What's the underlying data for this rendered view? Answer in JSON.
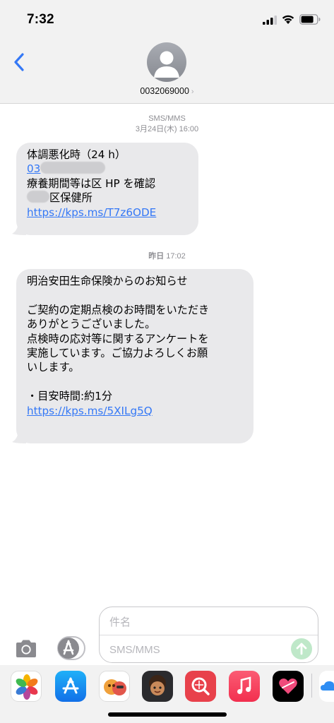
{
  "status_bar": {
    "time": "7:32"
  },
  "header": {
    "contact_number": "0032069000"
  },
  "thread": {
    "timestamps": [
      {
        "label": "SMS/MMS",
        "date": "3月24日(木) 16:00"
      },
      {
        "day": "昨日",
        "time": "17:02"
      }
    ],
    "messages": [
      {
        "lines": [
          "体調悪化時（24 h）",
          "03",
          "療養期間等は区 HP を確認",
          "区保健所",
          "https://kps.ms/T7z6ODE"
        ]
      },
      {
        "lines": [
          "明治安田生命保険からのお知らせ",
          "",
          "ご契約の定期点検のお時間をいただき",
          "ありがとうございました。",
          "点検時の応対等に関するアンケートを",
          "実施しています。ご協力よろしくお願",
          "いします。",
          "",
          "・目安時間:約1分",
          "https://kps.ms/5XILg5Q"
        ]
      }
    ]
  },
  "composer": {
    "subject_placeholder": "件名",
    "message_placeholder": "SMS/MMS"
  },
  "app_drawer": {
    "icons": [
      "photos-icon",
      "app-store-icon",
      "memoji-stickers-icon",
      "memoji-icon",
      "search-images-icon",
      "music-icon",
      "digital-touch-icon",
      "more-apps-icon"
    ]
  },
  "colors": {
    "accent": "#3478f6",
    "bubble": "#e9e9eb",
    "send": "#bfe8c9"
  }
}
